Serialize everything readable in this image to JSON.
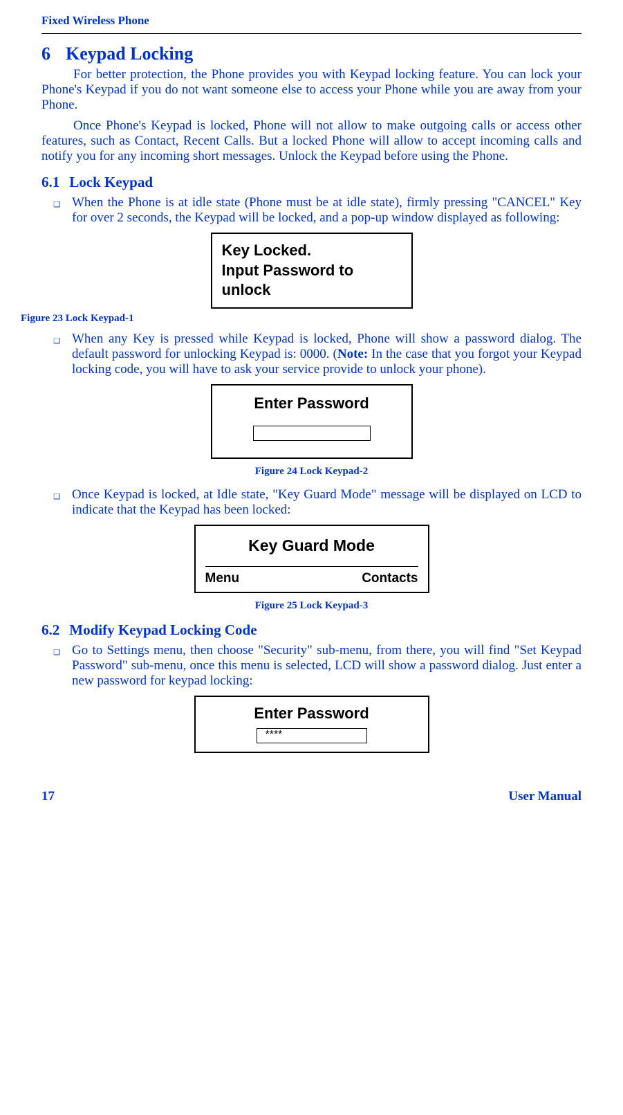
{
  "header": {
    "product": "Fixed Wireless Phone"
  },
  "sec6": {
    "num": "6",
    "title": "Keypad Locking",
    "p1": "For better protection, the Phone provides you with Keypad locking feature. You can lock your Phone's Keypad if you do not want someone else to access your Phone while you are away from your Phone.",
    "p2": "Once Phone's Keypad is locked,  Phone will not allow to make outgoing calls or access other features, such as Contact, Recent Calls.  But a locked Phone will allow to accept incoming calls and notify you for any incoming short messages.  Unlock the Keypad before using the Phone."
  },
  "sec61": {
    "num": "6.1",
    "title": "Lock Keypad",
    "b1": "When the Phone is at idle state (Phone must be at idle state), firmly pressing \"CANCEL\" Key for over 2 seconds, the Keypad will be locked, and a pop-up window displayed as following:",
    "b2a": "When any Key is pressed while Keypad is locked, Phone will show a password dialog. The default password for unlocking Keypad is: 0000. (",
    "b2note": "Note:",
    "b2b": " In the case that you forgot your Keypad locking code, you will have to ask your service provide to unlock your phone).",
    "b3": "Once Keypad is locked, at Idle state,  \"Key Guard Mode\" message will be displayed on LCD to indicate that the Keypad has been locked:"
  },
  "screen1": {
    "line1": "Key Locked.",
    "line2": "Input Password to",
    "line3": "unlock"
  },
  "fig23": "Figure 23 Lock Keypad-1",
  "screen2": {
    "title": "Enter Password",
    "value": ""
  },
  "fig24": "Figure 24 Lock Keypad-2",
  "screen3": {
    "title": "Key Guard Mode",
    "left": "Menu",
    "right": "Contacts"
  },
  "fig25": "Figure 25 Lock Keypad-3",
  "sec62": {
    "num": "6.2",
    "title": "Modify Keypad Locking Code",
    "b1": "Go to Settings menu, then choose \"Security\" sub-menu, from there, you will find \"Set Keypad Password\" sub-menu, once this menu is selected,  LCD will show a password dialog. Just enter a new password for keypad locking:"
  },
  "screen4": {
    "title": "Enter Password",
    "value": "****"
  },
  "footer": {
    "page": "17",
    "label": "User Manual"
  }
}
